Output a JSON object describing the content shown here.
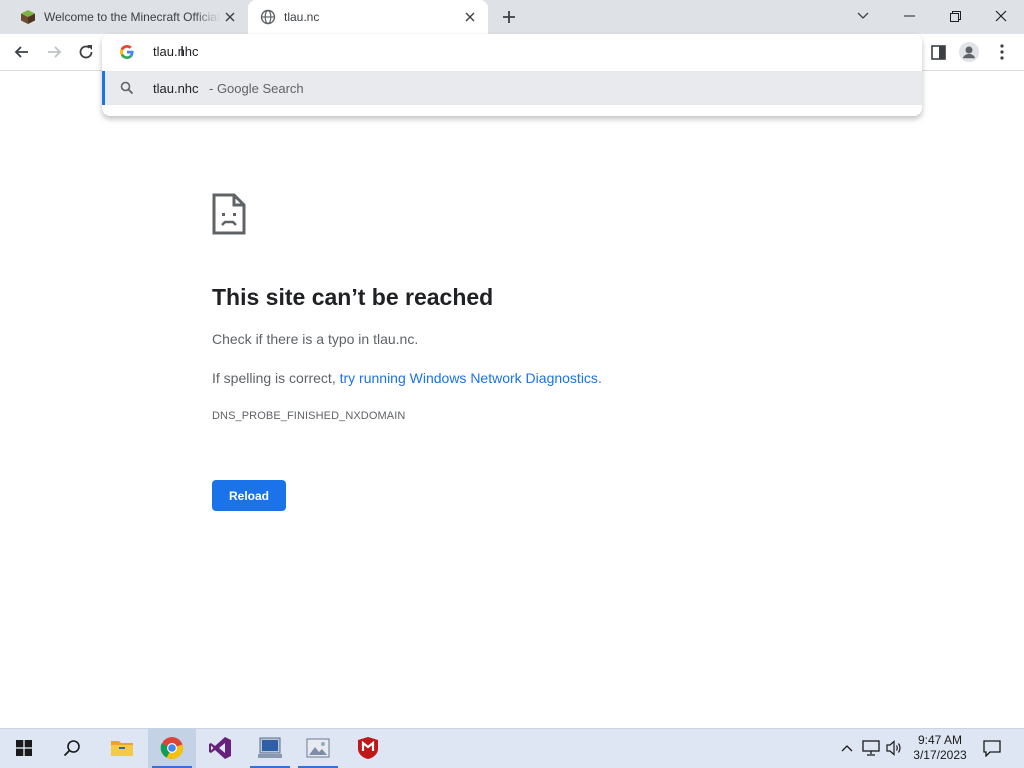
{
  "browser": {
    "tabs": [
      {
        "title": "Welcome to the Minecraft Official Site",
        "active": false
      },
      {
        "title": "tlau.nc",
        "active": true
      }
    ],
    "omnibox": {
      "value": "tlau.nhc",
      "suggestion_primary": "tlau.nhc",
      "suggestion_secondary": "- Google Search"
    }
  },
  "error_page": {
    "title": "This site can’t be reached",
    "line1": "Check if there is a typo in tlau.nc.",
    "line2_prefix": "If spelling is correct, ",
    "line2_link": "try running Windows Network Diagnostics",
    "line2_suffix": ".",
    "error_code": "DNS_PROBE_FINISHED_NXDOMAIN",
    "reload_label": "Reload"
  },
  "taskbar": {
    "apps": [
      "start-icon",
      "search-icon",
      "file-explorer-icon",
      "chrome-icon",
      "visual-studio-icon",
      "app-icon",
      "photos-icon",
      "mcafee-icon"
    ],
    "time": "9:47 AM",
    "date": "3/17/2023"
  },
  "colors": {
    "accent": "#1a73e8",
    "tabstrip": "#dee1e6",
    "taskbar": "#dde6f2"
  }
}
